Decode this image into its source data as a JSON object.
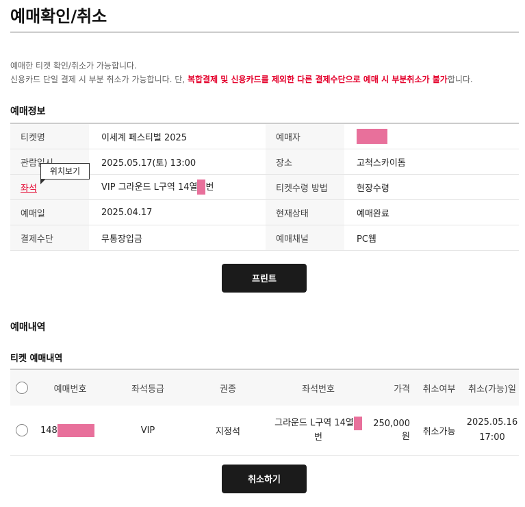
{
  "page": {
    "title": "예매확인/취소",
    "notice_line1": "예매한 티켓 확인/취소가 가능합니다.",
    "notice_line2_prefix": "신용카드 단일 결제 시 부분 취소가 가능합니다. 단, ",
    "notice_line2_red": "복합결제 및 신용카드를 제외한 다른 결제수단으로 예매 시 부분취소가 불가",
    "notice_line2_suffix": "합니다."
  },
  "booking_info": {
    "section_title": "예매정보",
    "rows": [
      {
        "label1": "티켓명",
        "value1": "이세계 페스티벌 2025",
        "label2": "예매자",
        "value2": ""
      },
      {
        "label1": "관람일시",
        "value1": "2025.05.17(토) 13:00",
        "label2": "장소",
        "value2": "고척스카이돔"
      },
      {
        "label1": "좌석",
        "value1_prefix": "VIP 그라운드 L구역 14열",
        "value1_suffix": "번",
        "label2": "티켓수령 방법",
        "value2": "현장수령"
      },
      {
        "label1": "예매일",
        "value1": "2025.04.17",
        "label2": "현재상태",
        "value2": "예매완료"
      },
      {
        "label1": "결제수단",
        "value1": "무통장입금",
        "label2": "예매채널",
        "value2": "PC웹"
      }
    ],
    "tooltip": "위치보기",
    "print_button": "프린트"
  },
  "history": {
    "section_title": "예매내역",
    "sub_title": "티켓 예매내역",
    "columns": [
      "예매번호",
      "좌석등급",
      "권종",
      "좌석번호",
      "가격",
      "취소여부",
      "취소(가능)일"
    ],
    "rows": [
      {
        "booking_no_prefix": "148",
        "grade": "VIP",
        "ticket_type": "지정석",
        "seat_prefix": "그라운드 L구역 14열",
        "seat_suffix": "번",
        "price": "250,000원",
        "cancel_status": "취소가능",
        "cancel_date": "2025.05.16",
        "cancel_time": "17:00"
      }
    ],
    "cancel_button": "취소하기"
  },
  "colors": {
    "accent_red": "#e4002b",
    "mask_pink": "#e8709b",
    "button_dark": "#1b1b1b"
  }
}
